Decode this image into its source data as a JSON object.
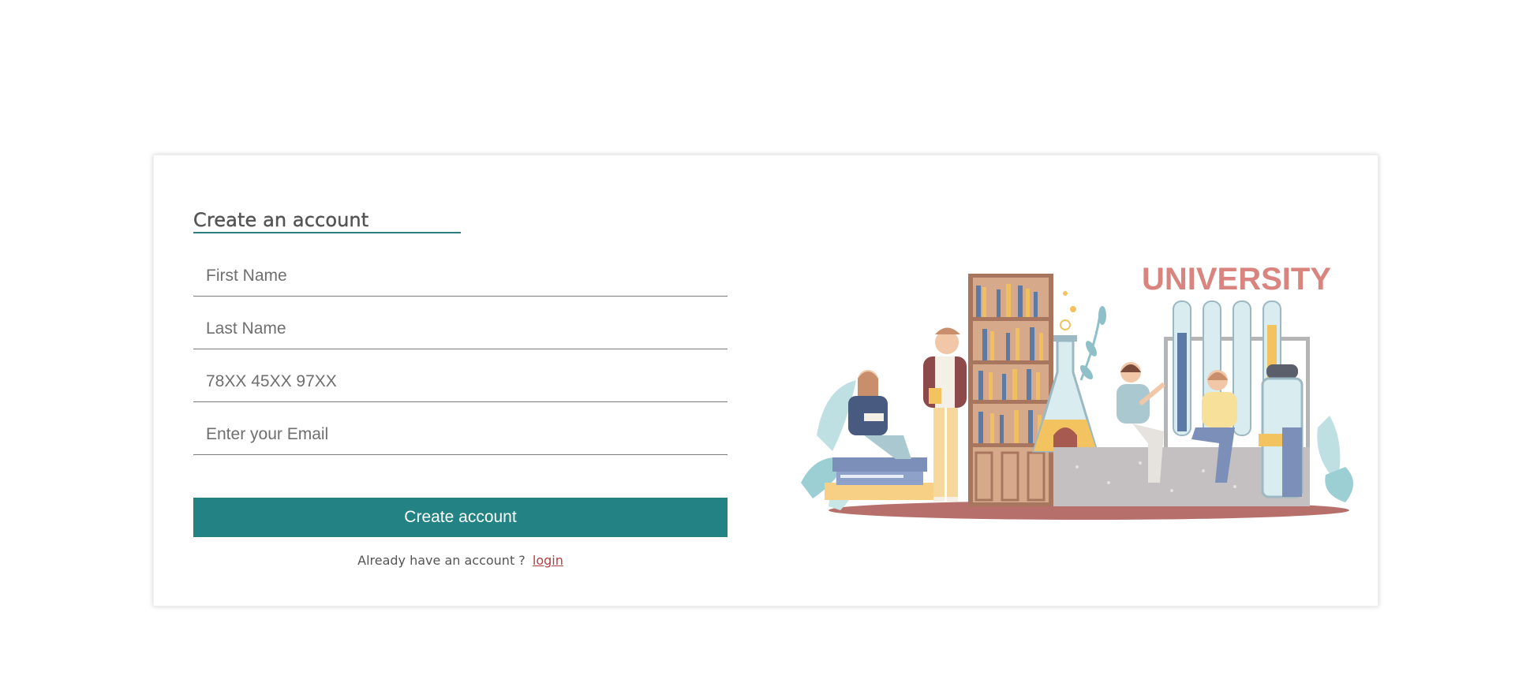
{
  "form": {
    "title": "Create an account",
    "fields": [
      {
        "placeholder": "First Name",
        "value": ""
      },
      {
        "placeholder": "Last Name",
        "value": ""
      },
      {
        "placeholder": "78XX 45XX 97XX",
        "value": ""
      },
      {
        "placeholder": "Enter your Email",
        "value": ""
      }
    ],
    "submit_label": "Create account",
    "login_prompt": "Already have an account ?",
    "login_link": "login"
  },
  "illustration": {
    "sign_text": "UNIVERSITY"
  },
  "colors": {
    "accent": "#238384",
    "link": "#b0413e",
    "title": "#555555"
  }
}
